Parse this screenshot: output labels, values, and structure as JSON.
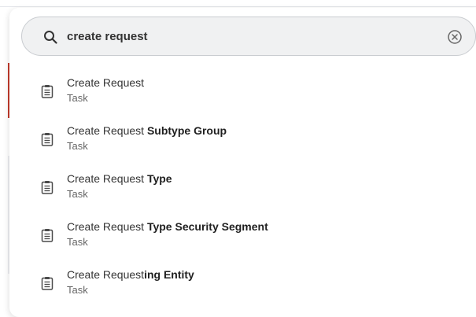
{
  "search": {
    "value": "create request",
    "icon": "search-icon",
    "clear_icon": "clear-circle-icon"
  },
  "results": [
    {
      "title_plain": "Create Request",
      "title_bold": "",
      "subtitle": "Task",
      "icon": "clipboard-icon"
    },
    {
      "title_plain": "Create Request ",
      "title_bold": "Subtype Group",
      "subtitle": "Task",
      "icon": "clipboard-icon"
    },
    {
      "title_plain": "Create Request ",
      "title_bold": "Type",
      "subtitle": "Task",
      "icon": "clipboard-icon"
    },
    {
      "title_plain": "Create Request ",
      "title_bold": "Type Security Segment",
      "subtitle": "Task",
      "icon": "clipboard-icon"
    },
    {
      "title_plain": "Create Request",
      "title_bold": "ing Entity",
      "subtitle": "Task",
      "icon": "clipboard-icon"
    }
  ],
  "colors": {
    "accent_red": "#c0392b",
    "search_bg": "#f0f1f2",
    "text_primary": "#333333",
    "text_secondary": "#666666"
  }
}
